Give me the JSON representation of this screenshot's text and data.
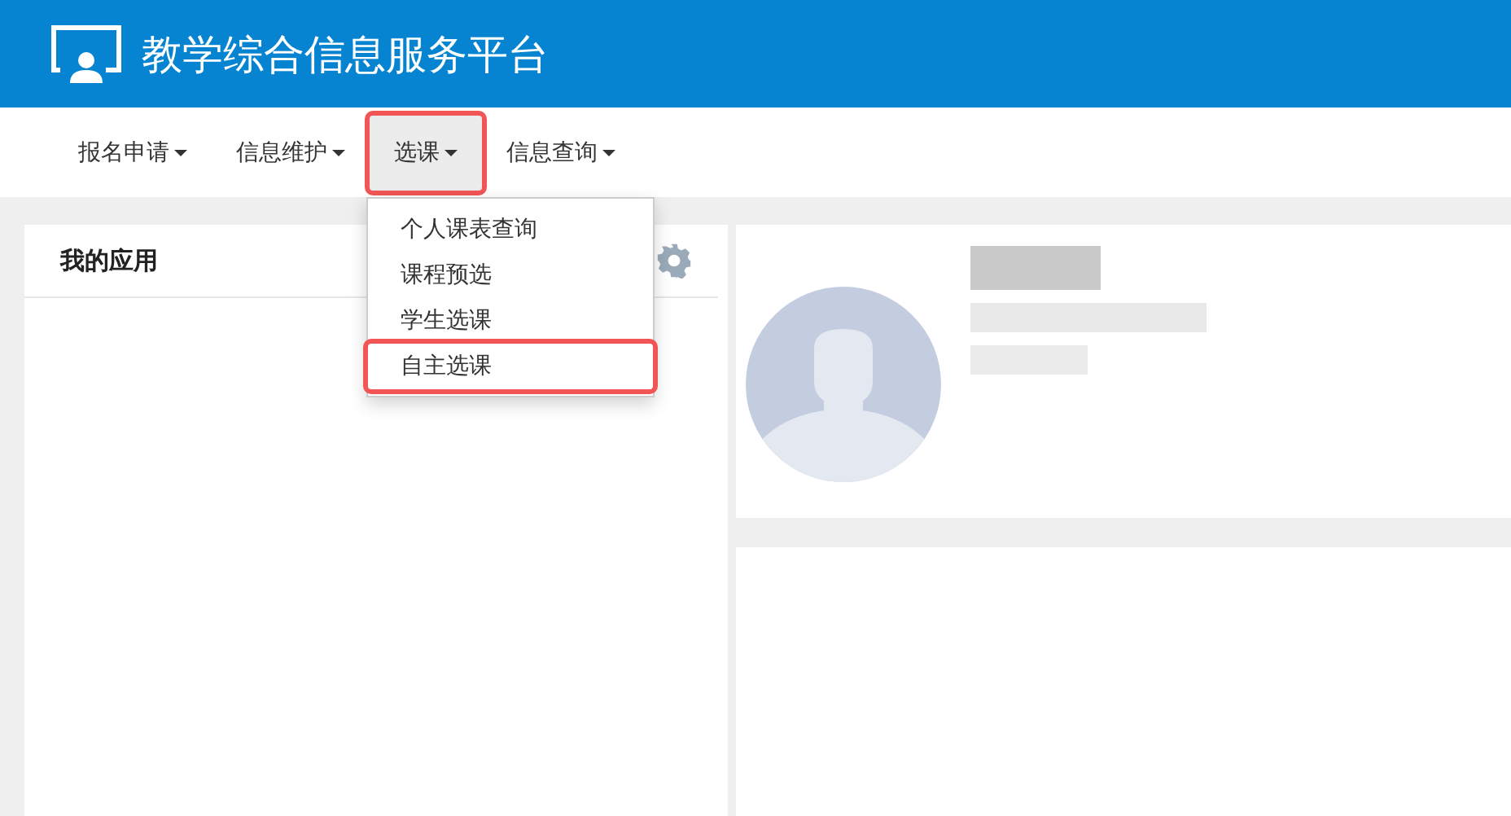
{
  "header": {
    "title": "教学综合信息服务平台"
  },
  "nav": [
    {
      "label": "报名申请",
      "selected": false,
      "highlighted": false
    },
    {
      "label": "信息维护",
      "selected": false,
      "highlighted": false
    },
    {
      "label": "选课",
      "selected": true,
      "highlighted": true
    },
    {
      "label": "信息查询",
      "selected": false,
      "highlighted": false
    }
  ],
  "dropdown": {
    "items": [
      {
        "label": "个人课表查询",
        "highlighted": false
      },
      {
        "label": "课程预选",
        "highlighted": false
      },
      {
        "label": "学生选课",
        "highlighted": false
      },
      {
        "label": "自主选课",
        "highlighted": true
      }
    ]
  },
  "apps_panel": {
    "title": "我的应用"
  }
}
